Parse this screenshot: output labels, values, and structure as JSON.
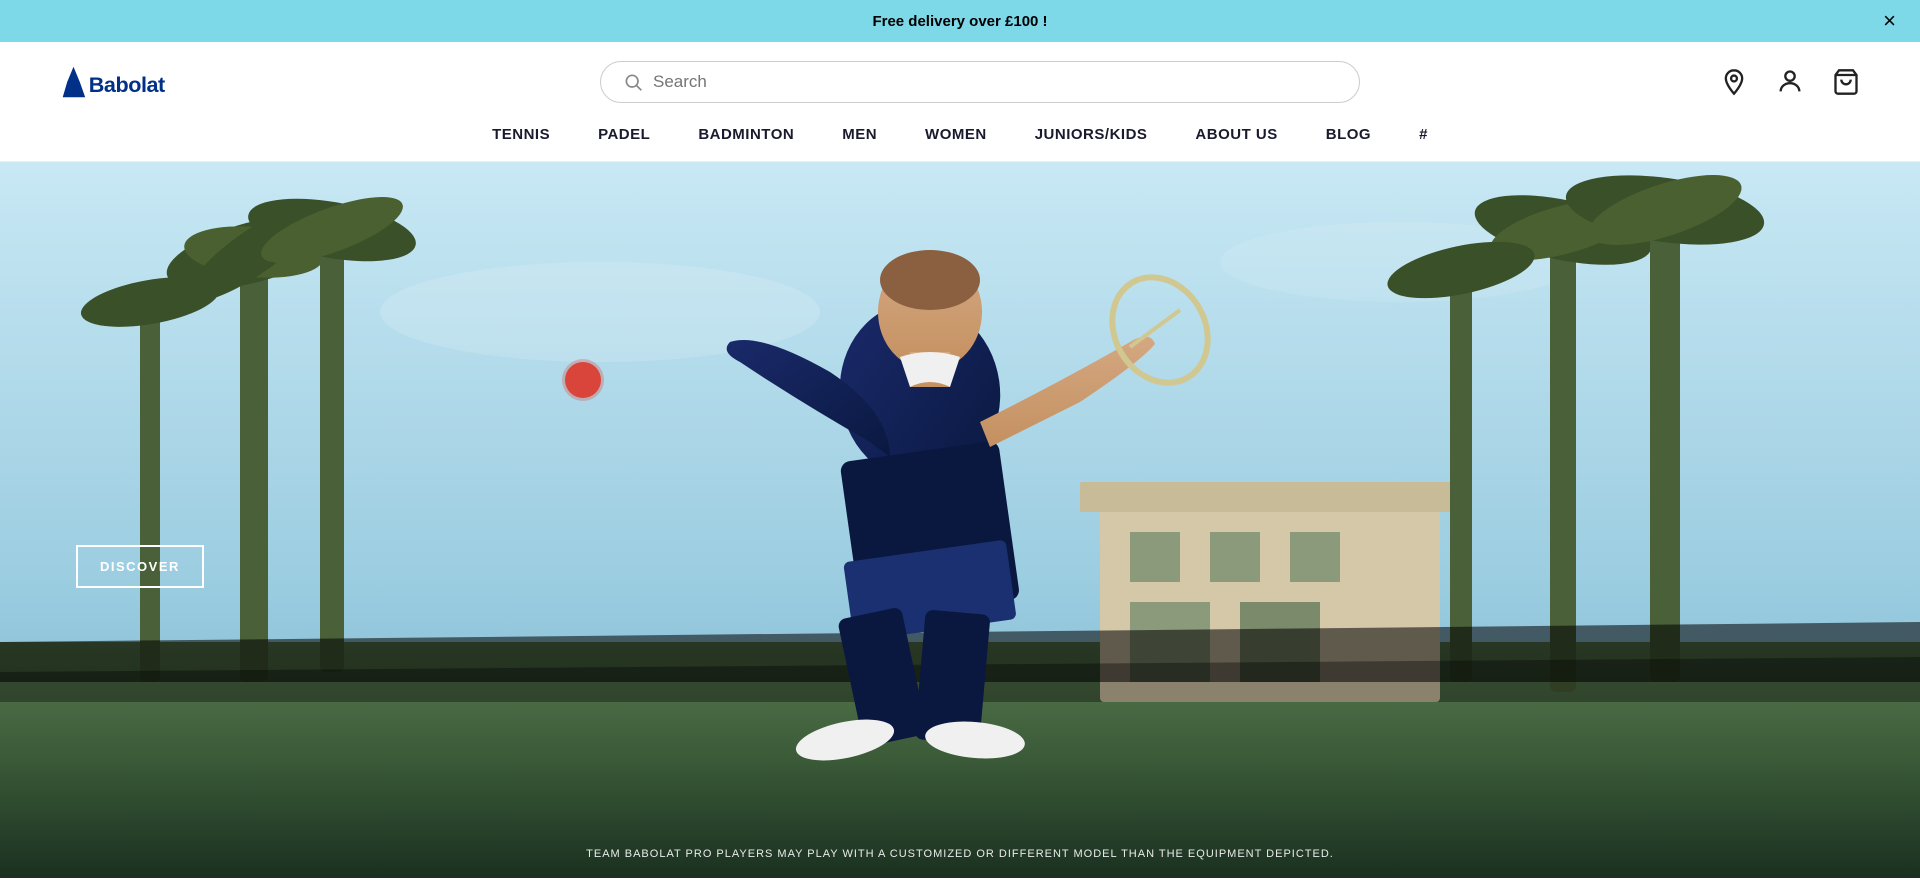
{
  "announcement": {
    "text": "Free delivery over £100 !",
    "close_label": "×"
  },
  "header": {
    "logo_alt": "Babolat",
    "search_placeholder": "Search"
  },
  "nav": {
    "items": [
      {
        "label": "TENNIS",
        "id": "tennis"
      },
      {
        "label": "PADEL",
        "id": "padel"
      },
      {
        "label": "BADMINTON",
        "id": "badminton"
      },
      {
        "label": "MEN",
        "id": "men"
      },
      {
        "label": "WOMEN",
        "id": "women"
      },
      {
        "label": "JUNIORS/KIDS",
        "id": "juniors"
      },
      {
        "label": "ABOUT US",
        "id": "about"
      },
      {
        "label": "BLOG",
        "id": "blog"
      },
      {
        "label": "#",
        "id": "hashtag"
      }
    ]
  },
  "hero": {
    "discover_label": "DISCOVER",
    "footer_text": "TEAM BABOLAT PRO PLAYERS MAY PLAY WITH A CUSTOMIZED OR DIFFERENT MODEL THAN THE EQUIPMENT DEPICTED."
  }
}
